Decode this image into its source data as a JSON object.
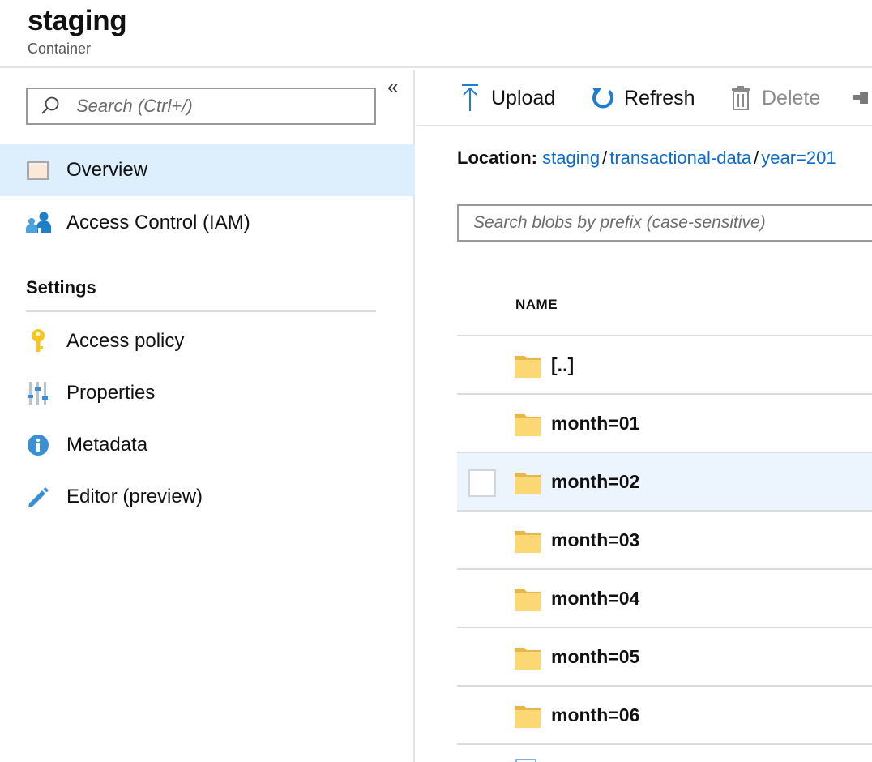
{
  "header": {
    "title": "staging",
    "subtitle": "Container"
  },
  "sidebar": {
    "collapse_label": "«",
    "search": {
      "placeholder": "Search (Ctrl+/)",
      "value": ""
    },
    "items": [
      {
        "label": "Overview",
        "icon": "overview-icon",
        "active": true
      },
      {
        "label": "Access Control (IAM)",
        "icon": "users-icon",
        "active": false
      }
    ],
    "settings_title": "Settings",
    "settings_items": [
      {
        "label": "Access policy",
        "icon": "key-icon"
      },
      {
        "label": "Properties",
        "icon": "sliders-icon"
      },
      {
        "label": "Metadata",
        "icon": "info-icon"
      },
      {
        "label": "Editor (preview)",
        "icon": "pencil-icon"
      }
    ]
  },
  "toolbar": {
    "upload_label": "Upload",
    "refresh_label": "Refresh",
    "delete_label": "Delete"
  },
  "location": {
    "label": "Location:",
    "crumbs": [
      "staging",
      "transactional-data",
      "year=201"
    ],
    "separator": "/"
  },
  "blob_search": {
    "placeholder": "Search blobs by prefix (case-sensitive)",
    "value": ""
  },
  "table": {
    "name_header": "NAME",
    "rows": [
      "[..]",
      "month=01",
      "month=02",
      "month=03",
      "month=04",
      "month=05",
      "month=06"
    ],
    "hovered_row": "month=02"
  },
  "colors": {
    "accent": "#0b6acb",
    "active_nav_bg": "#ddeefc",
    "row_hover_bg": "#ecf4fd",
    "folder": "#fcd874",
    "key": "#f5c623"
  }
}
